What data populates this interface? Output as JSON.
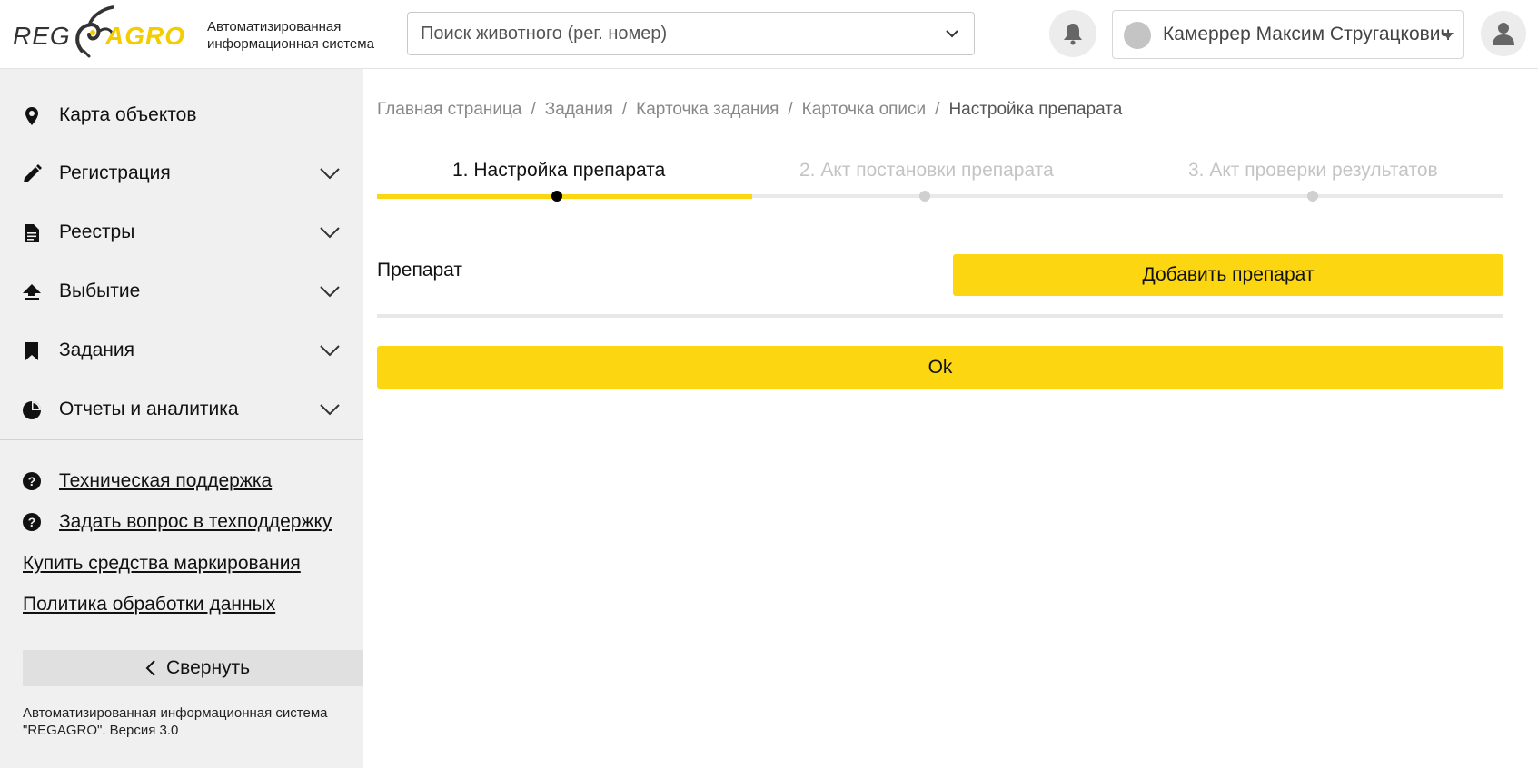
{
  "header": {
    "logo_reg": "REG",
    "logo_agro": "AGRO",
    "app_caption_line1": "Автоматизированная",
    "app_caption_line2": "информационная система",
    "search_placeholder": "Поиск животного (рег. номер)",
    "user_name": "Камеррер Максим Стругацкович",
    "accent_color": "#fcd610"
  },
  "sidebar": {
    "items": [
      {
        "label": "Карта объектов",
        "icon": "map-pin-icon",
        "expandable": false
      },
      {
        "label": "Регистрация",
        "icon": "pencil-icon",
        "expandable": true
      },
      {
        "label": "Реестры",
        "icon": "document-icon",
        "expandable": true
      },
      {
        "label": "Выбытие",
        "icon": "upload-icon",
        "expandable": true
      },
      {
        "label": "Задания",
        "icon": "bookmark-icon",
        "expandable": true
      },
      {
        "label": "Отчеты и аналитика",
        "icon": "pie-chart-icon",
        "expandable": true
      }
    ],
    "links": [
      {
        "label": "Техническая поддержка",
        "icon": "question-icon"
      },
      {
        "label": "Задать вопрос в техподдержку",
        "icon": "question-icon"
      },
      {
        "label": "Купить средства маркирования"
      },
      {
        "label": "Политика обработки данных"
      }
    ],
    "collapse_label": "Свернуть",
    "footer_line1": "Автоматизированная информационная система",
    "footer_line2": "\"REGAGRO\". Версия 3.0"
  },
  "breadcrumb": {
    "items": [
      "Главная страница",
      "Задания",
      "Карточка задания",
      "Карточка описи"
    ],
    "current": "Настройка препарата"
  },
  "steps": {
    "items": [
      {
        "label": "1. Настройка препарата",
        "state": "active"
      },
      {
        "label": "2. Акт постановки препарата",
        "state": "inactive"
      },
      {
        "label": "3. Акт проверки результатов",
        "state": "inactive"
      }
    ],
    "progress": 0.333
  },
  "form": {
    "field_label": "Препарат",
    "add_button": "Добавить препарат",
    "ok_button": "Ok"
  }
}
